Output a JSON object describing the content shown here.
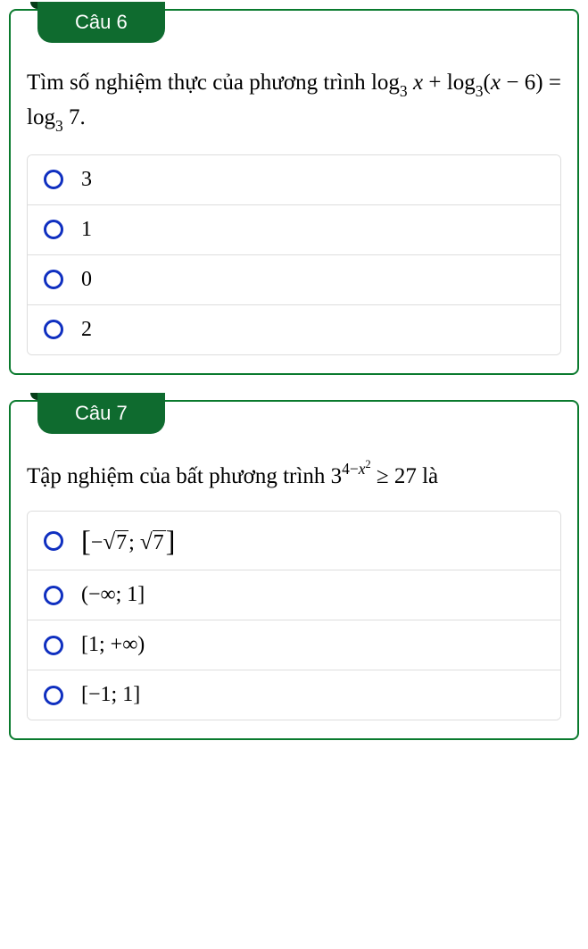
{
  "questions": [
    {
      "label": "Câu 6",
      "text_html": "Tìm số nghiệm thực của phương trình log<sub>3</sub> <i>x</i> + log<sub>3</sub>(<i>x</i> − 6) = log<sub>3</sub> 7.",
      "justify": true,
      "options": [
        {
          "html": "3"
        },
        {
          "html": "1"
        },
        {
          "html": "0"
        },
        {
          "html": "2"
        }
      ]
    },
    {
      "label": "Câu 7",
      "text_html": "Tập nghiệm của bất phương trình 3<sup>4−<i>x</i><sup>2</sup></sup> ≥ 27 là",
      "justify": false,
      "options": [
        {
          "html": "<span class='big-bracket'>[</span>−<span class='sqrt'><span>7</span></span>; <span class='sqrt'><span>7</span></span><span class='big-bracket'>]</span>"
        },
        {
          "html": "(−∞; 1]"
        },
        {
          "html": "[1; +∞)"
        },
        {
          "html": "[−1; 1]"
        }
      ]
    }
  ]
}
